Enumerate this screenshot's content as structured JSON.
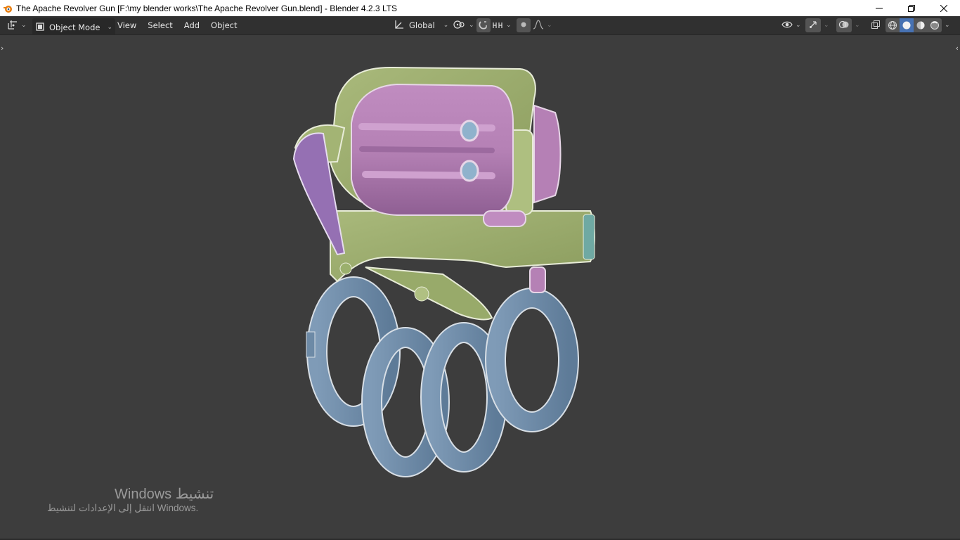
{
  "window": {
    "title": "The Apache Revolver Gun [F:\\my blender works\\The Apache Revolver Gun.blend] - Blender 4.2.3 LTS",
    "minimize": "—",
    "maximize": "❐",
    "close": "✕",
    "app_icon": "blender-logo-icon"
  },
  "header": {
    "editor_type_icon": "object-transform-icon",
    "mode_label": "Object Mode",
    "menus": [
      "View",
      "Select",
      "Add",
      "Object"
    ],
    "orientation_label": "Global",
    "pivot_icon": "pivot-icon",
    "snap_icon": "snap-magnet-icon",
    "proportional_icon": "proportional-editing-icon",
    "overlay_icons": [
      "visibility-eye-icon",
      "gizmo-icon",
      "overlays-icon",
      "xray-icon"
    ],
    "shading_icons": [
      "wireframe-shading-icon",
      "solid-shading-icon",
      "material-shading-icon",
      "rendered-shading-icon"
    ],
    "active_shading": "solid"
  },
  "watermark": {
    "line1": "Windows تنشيط",
    "line2": "انتقل إلى الإعدادات لتنشيط Windows."
  },
  "colors": {
    "viewport_bg": "#3d3d3d",
    "header_bg": "#303030",
    "active_blue": "#4772b3",
    "frame_green": "#9aab6c",
    "cylinder_pink": "#b07bb0",
    "knuckle_blue": "#6d8aa6"
  }
}
